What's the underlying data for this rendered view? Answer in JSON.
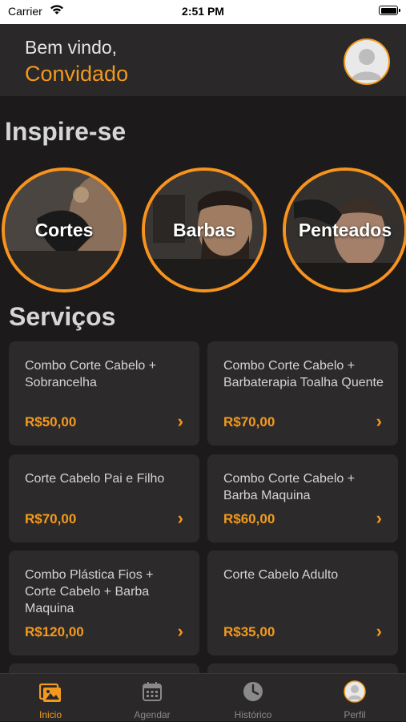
{
  "status_bar": {
    "carrier": "Carrier",
    "time": "2:51 PM"
  },
  "header": {
    "welcome": "Bem vindo,",
    "username": "Convidado"
  },
  "inspire": {
    "title": "Inspire-se",
    "items": [
      {
        "label": "Cortes"
      },
      {
        "label": "Barbas"
      },
      {
        "label": "Penteados"
      }
    ]
  },
  "services": {
    "title": "Serviços",
    "items": [
      {
        "title": "Combo Corte Cabelo + Sobrancelha",
        "price": "R$50,00"
      },
      {
        "title": "Combo Corte Cabelo + Barbaterapia Toalha Quente",
        "price": "R$70,00"
      },
      {
        "title": "Corte Cabelo Pai e Filho",
        "price": "R$70,00"
      },
      {
        "title": "Combo Corte Cabelo + Barba Maquina",
        "price": "R$60,00"
      },
      {
        "title": "Combo Plástica Fios + Corte Cabelo + Barba Maquina",
        "price": "R$120,00"
      },
      {
        "title": "Corte Cabelo Adulto",
        "price": "R$35,00"
      }
    ]
  },
  "tab_bar": {
    "items": [
      {
        "label": "Inicio",
        "icon": "gallery-icon",
        "active": true
      },
      {
        "label": "Agendar",
        "icon": "calendar-icon",
        "active": false
      },
      {
        "label": "Histórico",
        "icon": "clock-icon",
        "active": false
      },
      {
        "label": "Perfil",
        "icon": "profile-avatar-icon",
        "active": false
      }
    ]
  },
  "colors": {
    "accent": "#f39a1e",
    "background": "#1c1a1a",
    "card": "#2c2a2a",
    "header": "#2a2828"
  }
}
